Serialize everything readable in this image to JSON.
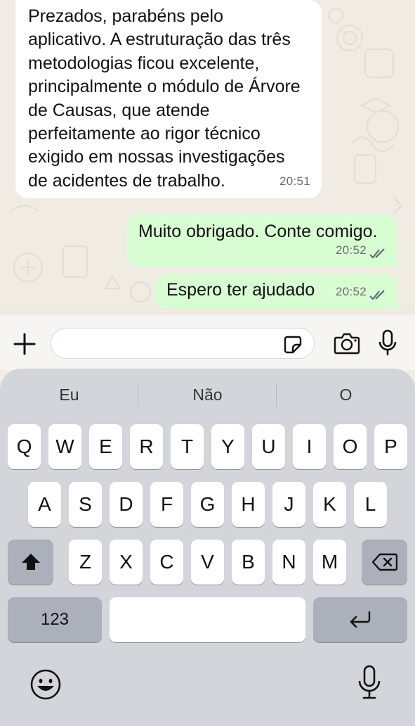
{
  "chat": {
    "messages": [
      {
        "direction": "incoming",
        "lines": [
          "Prezados, parabéns pelo",
          "aplicativo. A estruturação das três",
          "metodologias ficou excelente,",
          "principalmente o módulo de Árvore",
          "de Causas, que atende",
          "perfeitamente ao rigor técnico",
          "exigido em nossas investigações",
          "de acidentes de trabalho."
        ],
        "time": "20:51"
      },
      {
        "direction": "outgoing",
        "text": "Muito obrigado. Conte comigo.",
        "time": "20:52",
        "status": "read"
      },
      {
        "direction": "outgoing",
        "text": "Espero ter ajudado",
        "time": "20:52",
        "status": "read"
      }
    ]
  },
  "input_bar": {
    "attach_icon": "plus-icon",
    "sticker_icon": "sticker-icon",
    "camera_icon": "camera-icon",
    "mic_icon": "mic-icon",
    "value": ""
  },
  "keyboard": {
    "suggestions": [
      "Eu",
      "Não",
      "O"
    ],
    "row1": [
      "Q",
      "W",
      "E",
      "R",
      "T",
      "Y",
      "U",
      "I",
      "O",
      "P"
    ],
    "row2": [
      "A",
      "S",
      "D",
      "F",
      "G",
      "H",
      "J",
      "K",
      "L"
    ],
    "row3": [
      "Z",
      "X",
      "C",
      "V",
      "B",
      "N",
      "M"
    ],
    "numbers_label": "123",
    "shift_icon": "shift-icon",
    "backspace_icon": "backspace-icon",
    "return_icon": "return-icon",
    "emoji_icon": "emoji-icon",
    "dictation_icon": "mic-icon",
    "colors": {
      "keyboard_bg": "#d3d5da",
      "key_bg": "#ffffff"
    }
  },
  "colors": {
    "incoming_bubble": "#ffffff",
    "outgoing_bubble": "#d9fdd3",
    "read_ticks": "#53bdeb"
  }
}
